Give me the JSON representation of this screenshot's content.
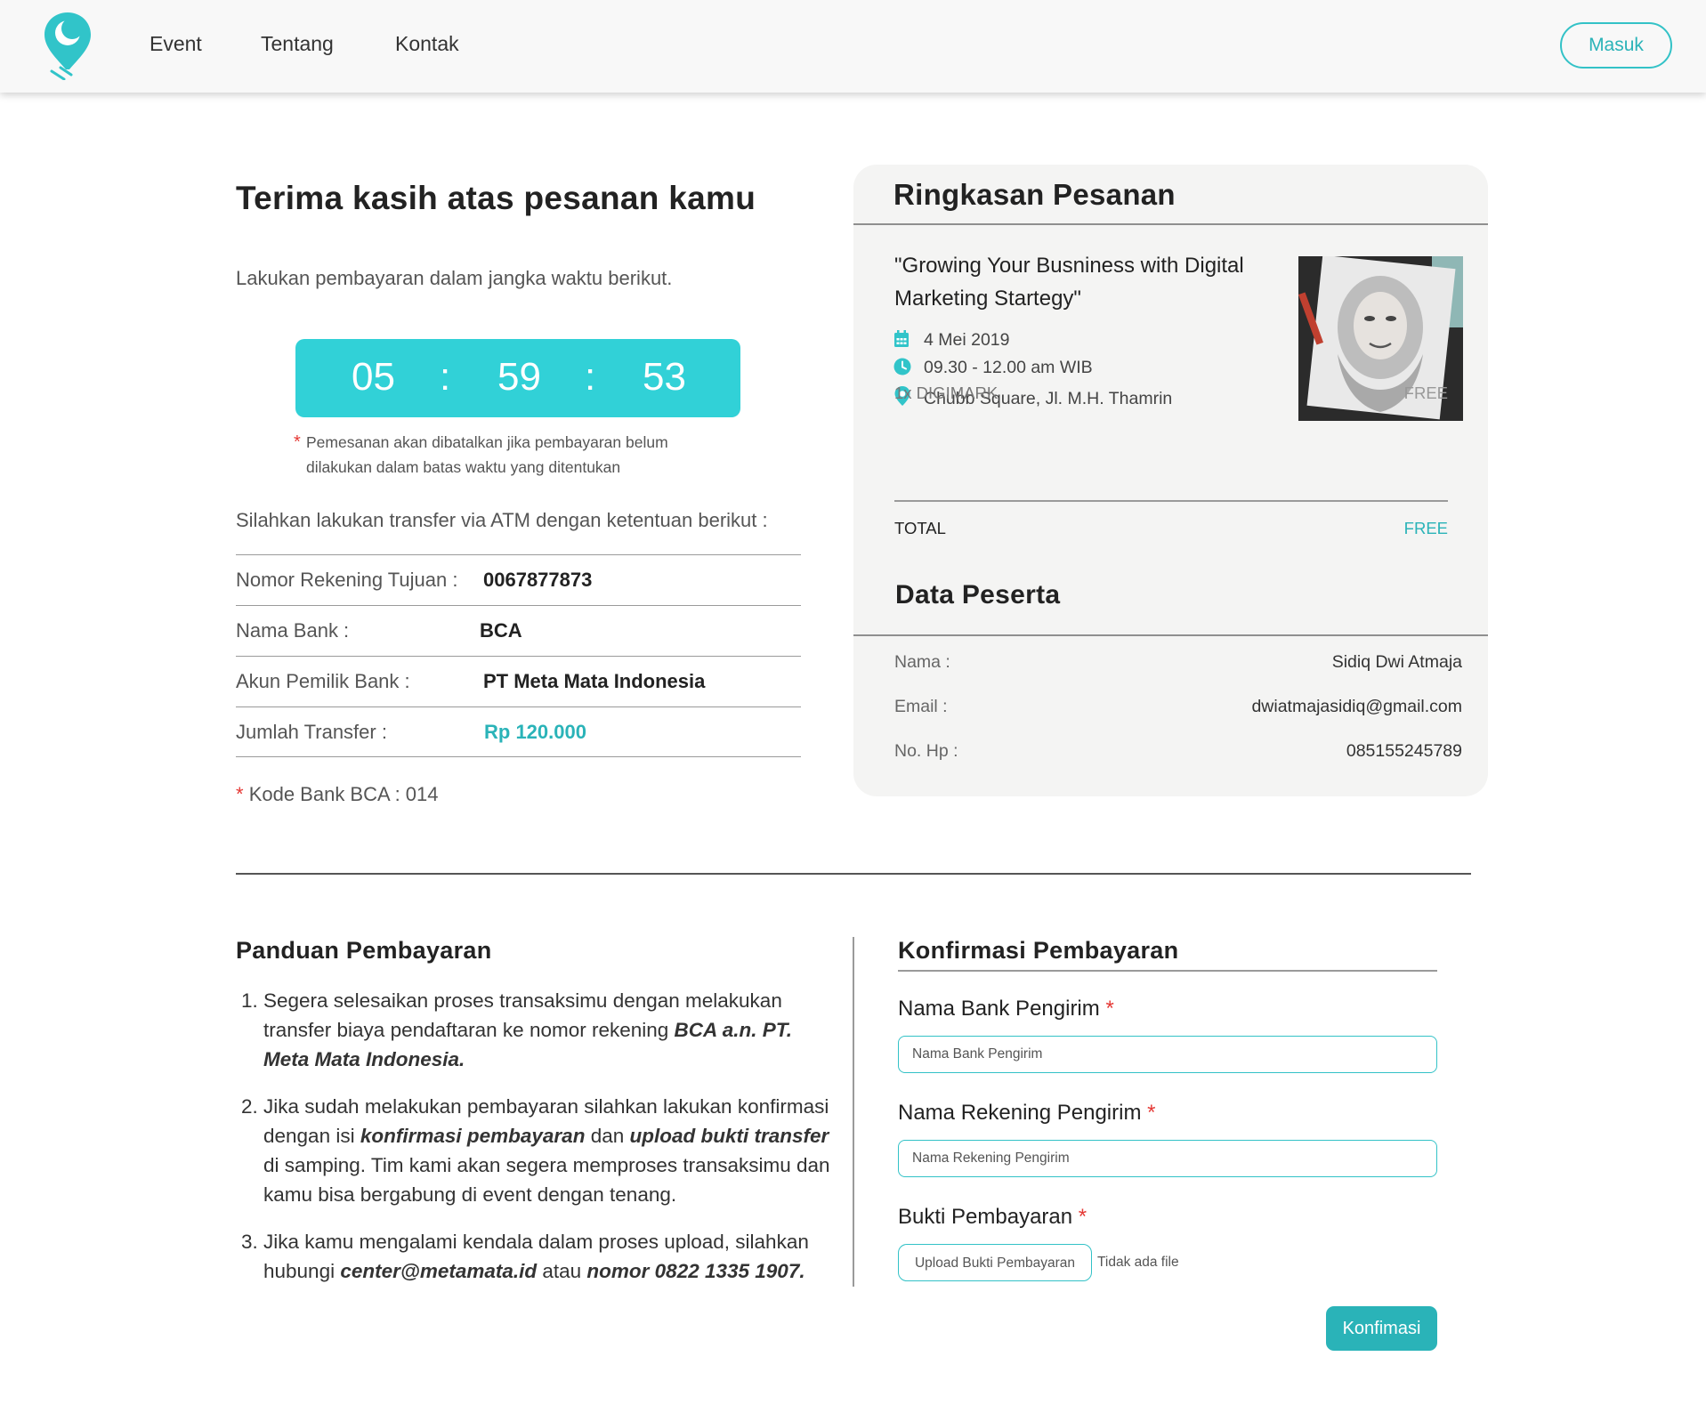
{
  "colors": {
    "accent": "#31d1d7",
    "accent_dark": "#2ab3b8",
    "required": "#e53935",
    "card_bg": "#f4f4f3"
  },
  "nav": {
    "logo_icon": "map-pin-logo-icon",
    "links": [
      "Event",
      "Tentang",
      "Kontak"
    ],
    "login_label": "Masuk"
  },
  "order": {
    "title": "Terima kasih atas pesanan kamu",
    "instruction": "Lakukan pembayaran dalam jangka waktu berikut.",
    "countdown": {
      "hours": "05",
      "minutes": "59",
      "seconds": "53",
      "separator": ":"
    },
    "cancel_note_marker": "*",
    "cancel_note": "Pemesanan akan dibatalkan jika pembayaran belum dilakukan dalam batas waktu yang ditentukan",
    "transfer_intro": "Silahkan lakukan transfer via ATM dengan ketentuan berikut :",
    "transfer_info": [
      {
        "label": "Nomor Rekening Tujuan :",
        "value": "0067877873"
      },
      {
        "label": "Nama Bank :",
        "value": "BCA"
      },
      {
        "label": "Akun Pemilik Bank :",
        "value": "PT Meta Mata Indonesia"
      },
      {
        "label": "Jumlah Transfer :",
        "value": "Rp 120.000"
      }
    ],
    "bank_code_marker": "*",
    "bank_code": "Kode Bank BCA : 014"
  },
  "summary": {
    "title": "Ringkasan Pesanan",
    "event_title": "\"Growing Your Busniness with Digital Marketing Startegy\"",
    "date": "4 Mei 2019",
    "time": "09.30 - 12.00 am WIB",
    "location": "Chubb Square, Jl. M.H. Thamrin",
    "icons": {
      "date": "calendar-icon",
      "time": "clock-icon",
      "location": "location-pin-icon"
    },
    "line_item": {
      "label": "1x DIGIMARK",
      "price": "FREE"
    },
    "total": {
      "label": "TOTAL",
      "price": "FREE"
    }
  },
  "participant": {
    "title": "Data Peserta",
    "rows": [
      {
        "label": "Nama :",
        "value": "Sidiq Dwi Atmaja"
      },
      {
        "label": "Email :",
        "value": "dwiatmajasidiq@gmail.com"
      },
      {
        "label": "No. Hp :",
        "value": "085155245789"
      }
    ]
  },
  "guide": {
    "title": "Panduan Pembayaran",
    "steps": [
      {
        "num": "1.",
        "parts": [
          "Segera selesaikan proses transaksimu dengan melakukan transfer biaya pendaftaran ke nomor rekening ",
          "BCA a.n. PT. Meta Mata Indonesia."
        ]
      },
      {
        "num": "2.",
        "parts": [
          "Jika sudah melakukan pembayaran silahkan lakukan konfirmasi dengan isi ",
          "konfirmasi pembayaran",
          " dan ",
          "upload bukti transfer",
          " di samping. Tim kami akan segera memproses transaksimu dan kamu bisa bergabung di event dengan tenang."
        ]
      },
      {
        "num": "3.",
        "parts": [
          "Jika kamu mengalami kendala dalam proses upload, silahkan hubungi ",
          "center@metamata.id",
          " atau ",
          "nomor 0822 1335 1907."
        ]
      }
    ]
  },
  "confirm": {
    "title": "Konfirmasi Pembayaran",
    "required_marker": "*",
    "bank_label": "Nama Bank Pengirim",
    "bank_placeholder": "Nama Bank Pengirim",
    "account_label": "Nama Rekening Pengirim",
    "account_placeholder": "Nama Rekening Pengirim",
    "proof_label": "Bukti Pembayaran",
    "upload_label": "Upload Bukti Pembayaran",
    "no_file": "Tidak ada file",
    "submit_label": "Konfimasi"
  }
}
